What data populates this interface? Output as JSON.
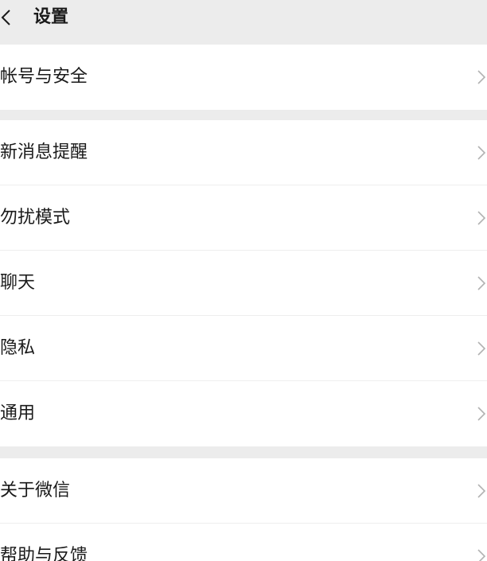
{
  "header": {
    "title": "设置",
    "back_icon": "chevron-left-icon"
  },
  "groups": [
    {
      "items": [
        {
          "label": "帐号与安全"
        }
      ]
    },
    {
      "items": [
        {
          "label": "新消息提醒"
        },
        {
          "label": "勿扰模式"
        },
        {
          "label": "聊天"
        },
        {
          "label": "隐私"
        },
        {
          "label": "通用"
        }
      ]
    },
    {
      "items": [
        {
          "label": "关于微信"
        },
        {
          "label": "帮助与反馈"
        }
      ]
    }
  ],
  "item_icon": "chevron-right-icon",
  "colors": {
    "background": "#ececec",
    "row_background": "#ffffff",
    "text": "#1a1a1a",
    "chevron": "#b2b2b2"
  }
}
